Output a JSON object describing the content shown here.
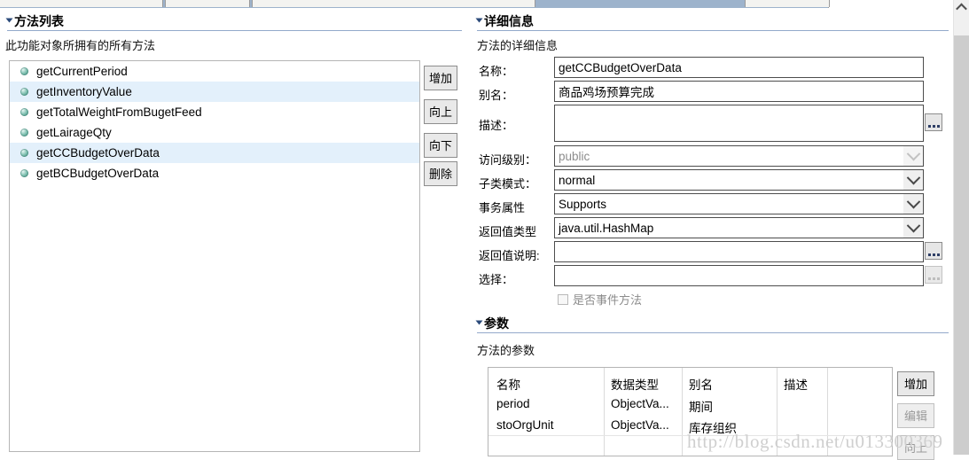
{
  "window": {
    "tabstrip_tabs": [
      "",
      "",
      "",
      "",
      ""
    ]
  },
  "method_list_panel": {
    "title": "方法列表",
    "subtitle": "此功能对象所拥有的所有方法",
    "items": [
      {
        "label": "getCurrentPeriod",
        "selected": false
      },
      {
        "label": "getInventoryValue",
        "selected": true
      },
      {
        "label": "getTotalWeightFromBugetFeed",
        "selected": false
      },
      {
        "label": "getLairageQty",
        "selected": false
      },
      {
        "label": "getCCBudgetOverData",
        "selected": true
      },
      {
        "label": "getBCBudgetOverData",
        "selected": false
      }
    ],
    "buttons": [
      {
        "label": "增加",
        "enabled": true
      },
      {
        "label": "向上",
        "enabled": true
      },
      {
        "label": "向下",
        "enabled": true
      },
      {
        "label": "删除",
        "enabled": true
      }
    ]
  },
  "details_panel": {
    "title": "详细信息",
    "subtitle": "方法的详细信息",
    "fields": {
      "name_label": "名称：",
      "name_value": "getCCBudgetOverData",
      "alias_label": "别名：",
      "alias_value": "商品鸡场预算完成",
      "description_label": "描述：",
      "description_value": "",
      "access_level_label": "访问级别：",
      "access_level_value": "public",
      "subclass_mode_label": "子类模式：",
      "subclass_mode_value": "normal",
      "transaction_attr_label": "事务属性",
      "transaction_attr_value": "Supports",
      "return_type_label": "返回值类型",
      "return_type_value": "java.util.HashMap",
      "return_desc_label": "返回值说明:",
      "return_desc_value": "",
      "select_label": "选择：",
      "select_value": "",
      "event_method_checkbox_label": "是否事件方法",
      "event_method_checked": false
    },
    "ellipsis_button_label": "..."
  },
  "params_panel": {
    "title": "参数",
    "subtitle": "方法的参数",
    "columns": [
      "名称",
      "数据类型",
      "别名",
      "描述",
      ""
    ],
    "rows": [
      [
        "period",
        "ObjectVa...",
        "期间",
        "",
        ""
      ],
      [
        "stoOrgUnit",
        "ObjectVa...",
        "库存组织",
        "",
        ""
      ],
      [
        "",
        "",
        "",
        "",
        ""
      ]
    ],
    "buttons": [
      {
        "label": "增加",
        "enabled": true
      },
      {
        "label": "编辑",
        "enabled": false
      },
      {
        "label": "向上",
        "enabled": false
      }
    ]
  },
  "watermark": {
    "text": "http://blog.csdn.net/u013300369"
  },
  "colors": {
    "selection": "#e3f0fb",
    "rule": "#93a9cb",
    "tabstrip": "#9db3cc",
    "scroll_thumb": "#cdcdcd"
  }
}
